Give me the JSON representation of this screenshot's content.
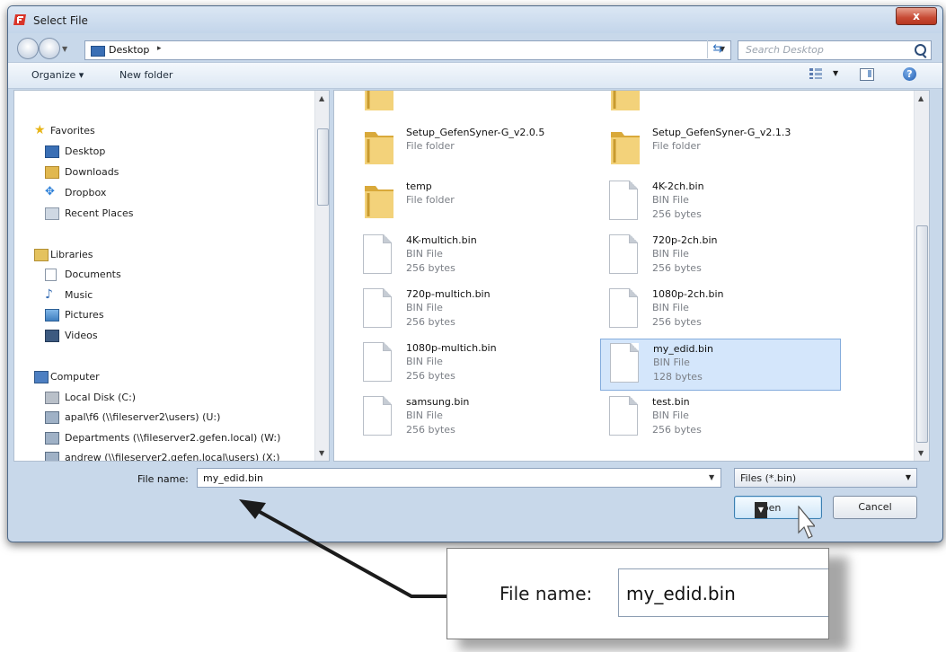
{
  "window": {
    "title": "Select File",
    "close_glyph": "x"
  },
  "nav": {
    "address_path": "Desktop",
    "search_placeholder": "Search Desktop"
  },
  "toolbar": {
    "organize": "Organize ▾",
    "new_folder": "New folder"
  },
  "sidebar": {
    "favorites": "Favorites",
    "items_fav": [
      "Desktop",
      "Downloads",
      "Dropbox",
      "Recent Places"
    ],
    "libraries": "Libraries",
    "items_lib": [
      "Documents",
      "Music",
      "Pictures",
      "Videos"
    ],
    "computer": "Computer",
    "items_comp": [
      "Local Disk (C:)",
      "apal\\f6 (\\\\fileserver2\\users) (U:)",
      "Departments (\\\\fileserver2.gefen.local) (W:)",
      "andrew (\\\\fileserver2.gefen.local\\users) (X:)"
    ]
  },
  "files": [
    {
      "name": "",
      "type": "File folder",
      "size": "",
      "kind": "folder"
    },
    {
      "name": "",
      "type": "File folder",
      "size": "",
      "kind": "folder"
    },
    {
      "name": "Setup_GefenSyner-G_v2.0.5",
      "type": "File folder",
      "size": "",
      "kind": "folder"
    },
    {
      "name": "Setup_GefenSyner-G_v2.1.3",
      "type": "File folder",
      "size": "",
      "kind": "folder"
    },
    {
      "name": "temp",
      "type": "File folder",
      "size": "",
      "kind": "folder"
    },
    {
      "name": "4K-2ch.bin",
      "type": "BIN File",
      "size": "256 bytes",
      "kind": "file"
    },
    {
      "name": "4K-multich.bin",
      "type": "BIN File",
      "size": "256 bytes",
      "kind": "file"
    },
    {
      "name": "720p-2ch.bin",
      "type": "BIN File",
      "size": "256 bytes",
      "kind": "file"
    },
    {
      "name": "720p-multich.bin",
      "type": "BIN File",
      "size": "256 bytes",
      "kind": "file"
    },
    {
      "name": "1080p-2ch.bin",
      "type": "BIN File",
      "size": "256 bytes",
      "kind": "file"
    },
    {
      "name": "1080p-multich.bin",
      "type": "BIN File",
      "size": "256 bytes",
      "kind": "file"
    },
    {
      "name": "my_edid.bin",
      "type": "BIN File",
      "size": "128 bytes",
      "kind": "file",
      "selected": true
    },
    {
      "name": "samsung.bin",
      "type": "BIN File",
      "size": "256 bytes",
      "kind": "file"
    },
    {
      "name": "test.bin",
      "type": "BIN File",
      "size": "256 bytes",
      "kind": "file"
    }
  ],
  "footer": {
    "filename_label": "File name:",
    "filename_value": "my_edid.bin",
    "filter": "Files (*.bin)",
    "open": "Open",
    "cancel": "Cancel"
  },
  "callout": {
    "label": "File name:",
    "value": "my_edid.bin"
  },
  "colors": {
    "selection": "#d4e6fb",
    "folder": "#e8c15a",
    "accent": "#2d6fbf"
  }
}
